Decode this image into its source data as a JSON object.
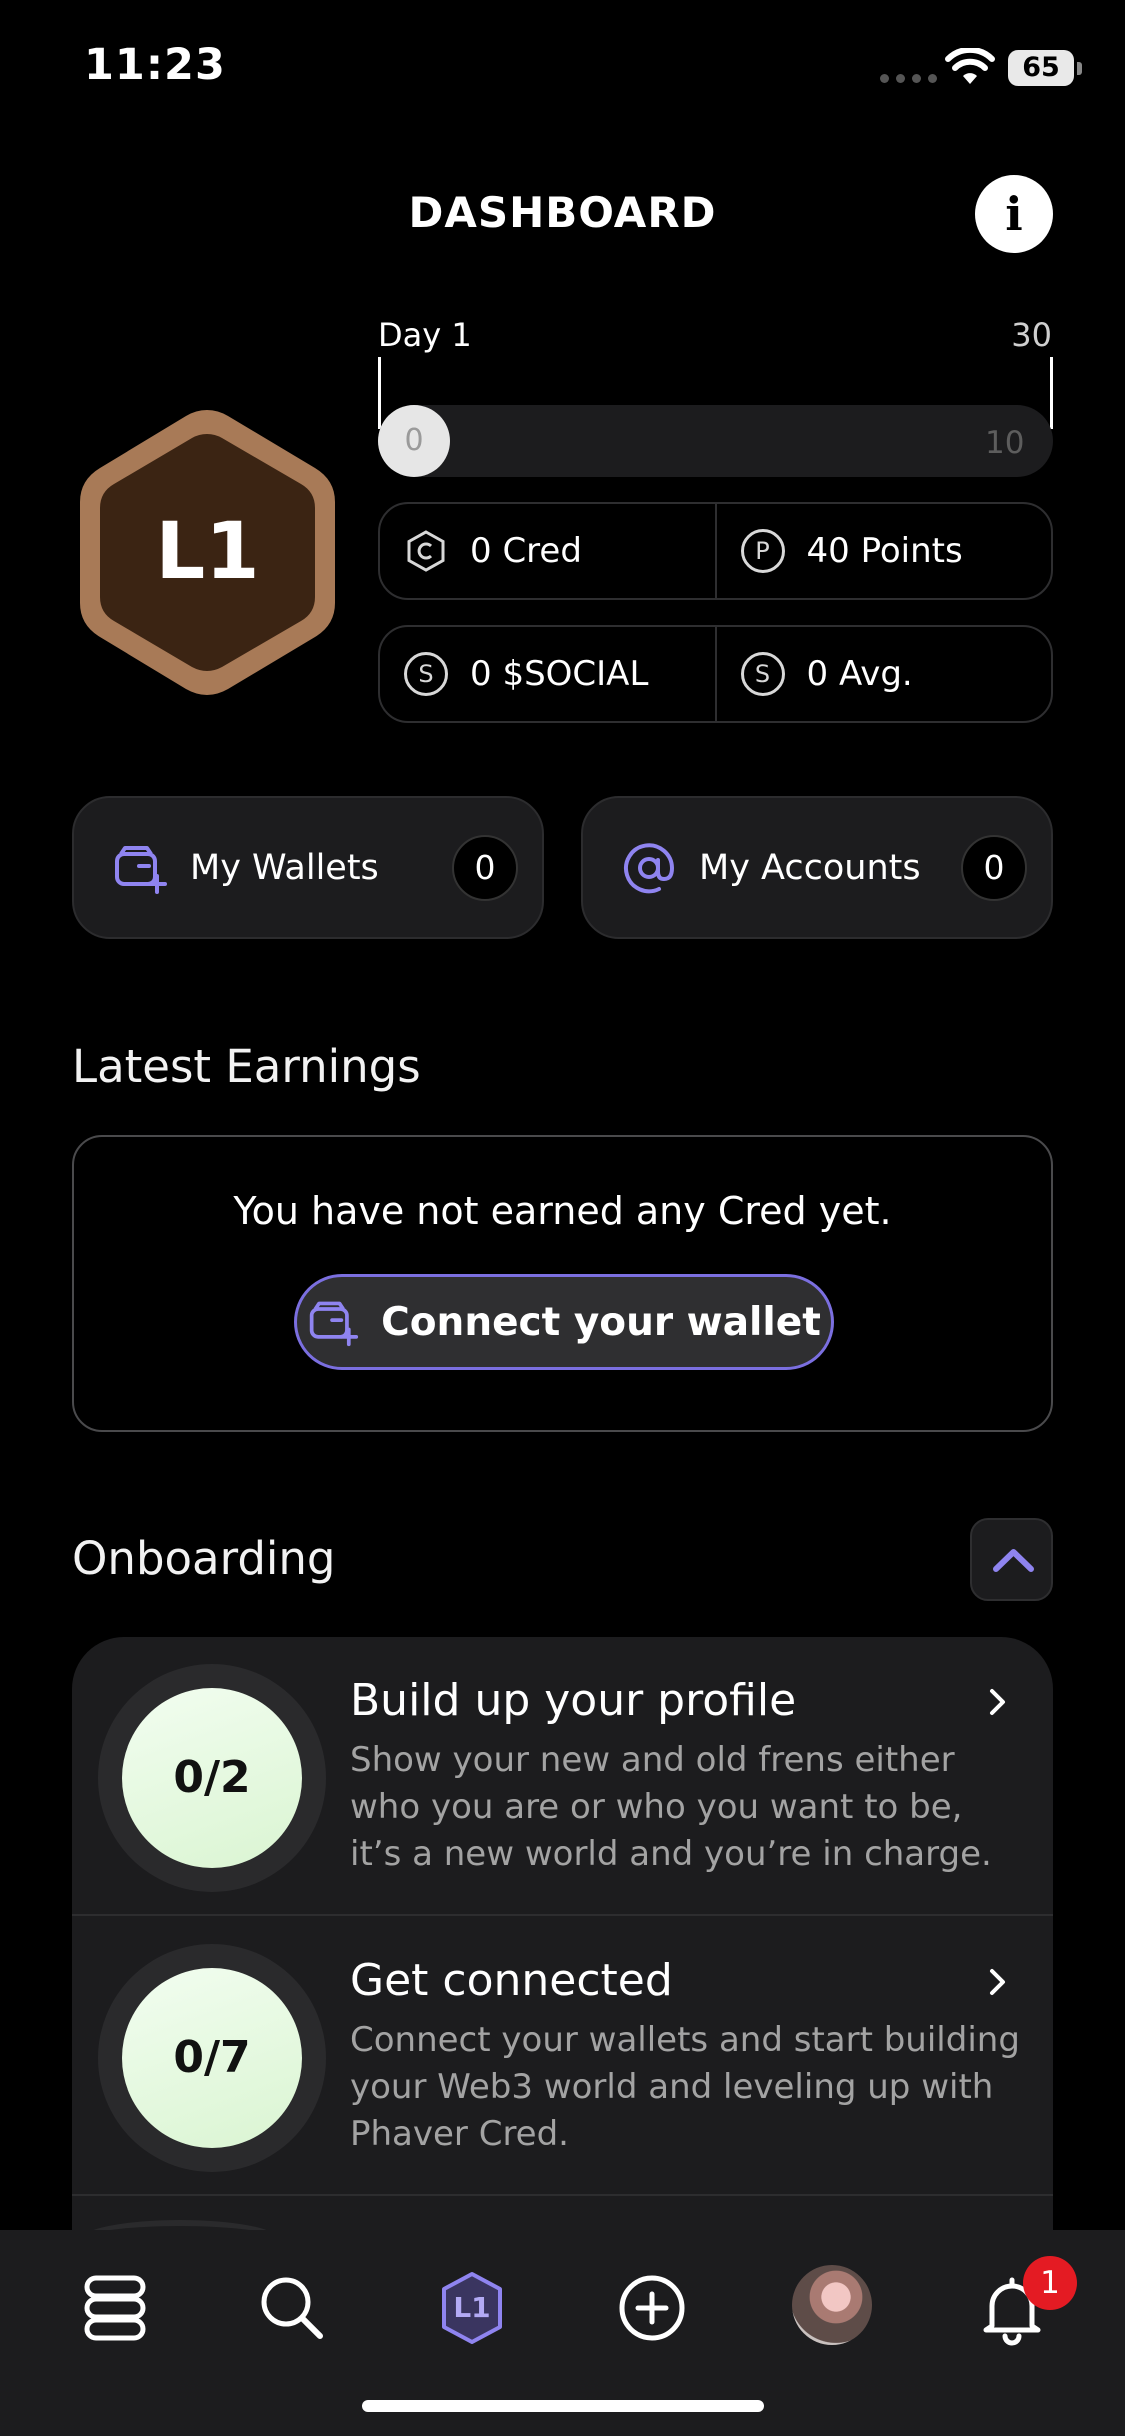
{
  "status_bar": {
    "time": "11:23",
    "battery": "65"
  },
  "header": {
    "title": "DASHBOARD"
  },
  "level": {
    "badge": "L1"
  },
  "progress": {
    "day_label": "Day 1",
    "day_max": "30",
    "current": "0",
    "target": "10",
    "fraction": 0
  },
  "stats": {
    "cred": "0 Cred",
    "points": "40 Points",
    "social": "0 $SOCIAL",
    "avg": "0 Avg.",
    "points_icon": "P",
    "social_icon": "S",
    "avg_icon": "S"
  },
  "wallets": {
    "label": "My Wallets",
    "count": "0"
  },
  "accounts": {
    "label": "My Accounts",
    "count": "0"
  },
  "earnings": {
    "title": "Latest Earnings",
    "message": "You have not earned any Cred yet.",
    "connect_label": "Connect your wallet"
  },
  "onboarding": {
    "title": "Onboarding",
    "items": [
      {
        "progress": "0/2",
        "title": "Build up your profile",
        "description": "Show your new and old frens either who you are or who you want to be, it’s a new world and you’re in charge."
      },
      {
        "progress": "0/7",
        "title": "Get connected",
        "description": "Connect your wallets and start building your Web3 world and leveling up with Phaver Cred."
      }
    ]
  },
  "tab_bar": {
    "level_tab": "L1",
    "notification_count": "1"
  },
  "colors": {
    "accent": "#7b6fe0",
    "badge_bronze": "#a87a57",
    "badge_fill": "#3b2413",
    "notification_red": "#e41b23",
    "card_bg": "#1c1c1e"
  }
}
